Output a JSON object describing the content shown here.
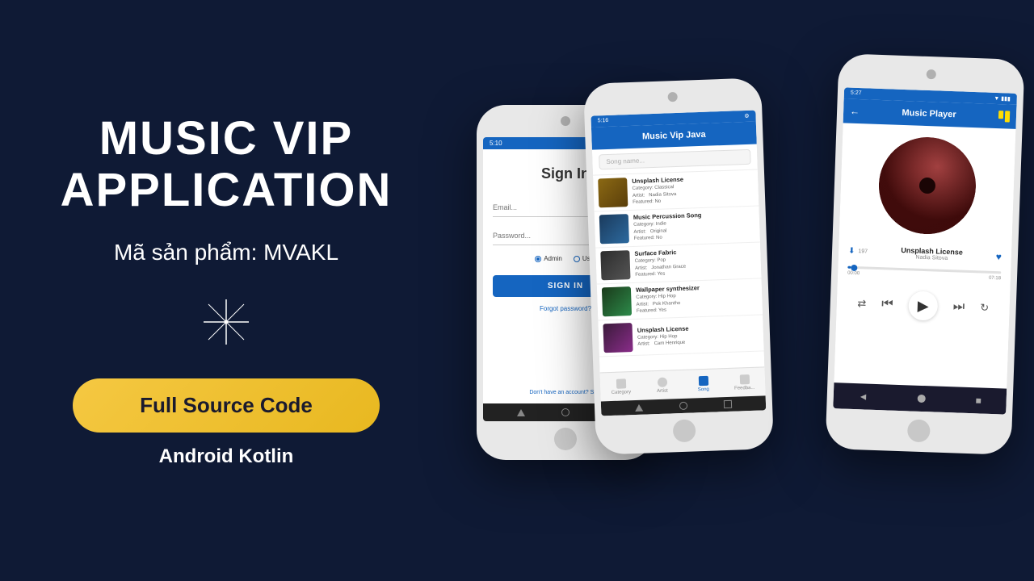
{
  "app": {
    "title_line1": "MUSIC VIP",
    "title_line2": "APPLICATION",
    "product_code": "Mã sản phẩm: MVAKL",
    "cta_button": "Full Source Code",
    "platform": "Android Kotlin"
  },
  "phone1": {
    "status_time": "5:10",
    "screen": "Sign In",
    "email_placeholder": "Email...",
    "password_placeholder": "Password...",
    "radio_admin": "Admin",
    "radio_user": "User",
    "sign_in_btn": "SIGN IN",
    "forgot_password": "Forgot password?",
    "no_account": "Don't have an account?",
    "sign_up": "Sign"
  },
  "phone2": {
    "status_time": "5:16",
    "header_title": "Music Vip Java",
    "search_placeholder": "Song name...",
    "songs": [
      {
        "name": "Unsplash License",
        "category": "Classical",
        "artist": "Nadia Sitova",
        "featured": "No",
        "thumb_class": "thumb-classical"
      },
      {
        "name": "Music Percussion Song",
        "category": "Indie",
        "artist": "Original",
        "featured": "No",
        "thumb_class": "thumb-indie"
      },
      {
        "name": "Surface Fabric",
        "category": "Pop",
        "artist": "Jonathan Grace",
        "featured": "Yes",
        "thumb_class": "thumb-pop"
      },
      {
        "name": "Wallpaper synthesizer",
        "category": "Hip Hop",
        "artist": "Pok Khantho",
        "featured": "Yes",
        "thumb_class": "thumb-hiphop1"
      },
      {
        "name": "Unsplash License",
        "category": "Hip Hop",
        "artist": "Cam Henrique",
        "featured": "",
        "thumb_class": "thumb-hiphop2"
      }
    ],
    "nav_items": [
      "Category",
      "Artist",
      "Song",
      "Feedba..."
    ]
  },
  "phone3": {
    "status_time": "5:27",
    "header_title": "Music Player",
    "track_name": "Unsplash License",
    "artist": "Nadia Sitova",
    "listen_count": "197",
    "time_current": "00:00",
    "time_total": "07:18",
    "progress_percent": 2
  },
  "colors": {
    "background": "#0f1a35",
    "primary_blue": "#1565c0",
    "button_yellow": "#f5c842",
    "white": "#ffffff"
  }
}
